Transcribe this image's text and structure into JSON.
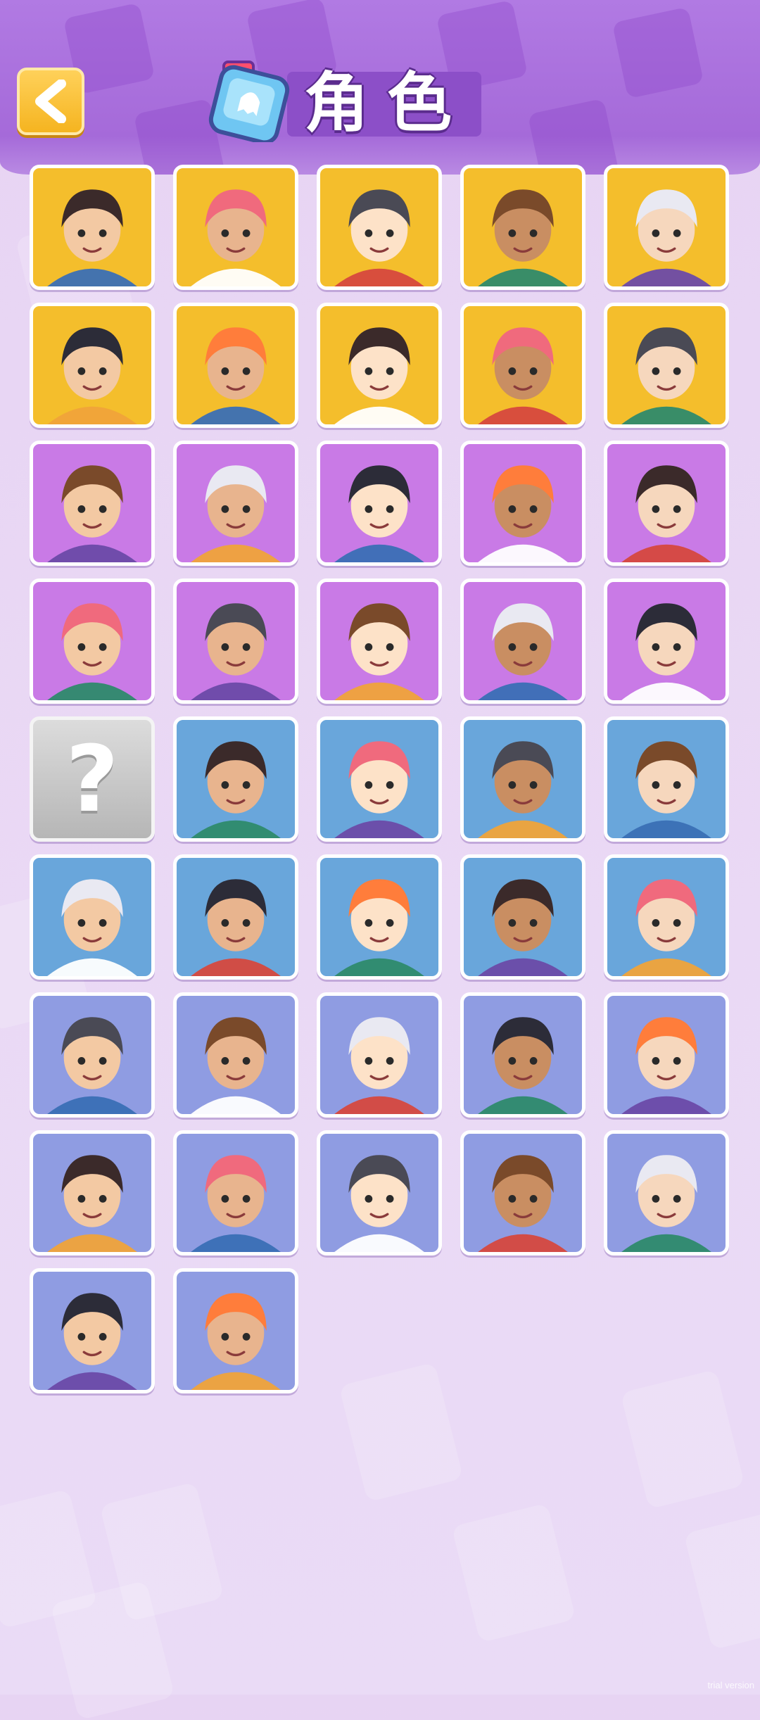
{
  "header": {
    "title": "角色",
    "back_icon": "chevron-left-icon",
    "title_icon": "character-card-icon"
  },
  "colors": {
    "yellow": "#f4be2c",
    "magenta": "#c97ae6",
    "blue": "#69a6db",
    "periwinkle": "#8f9ce2",
    "header": "#a56ad9"
  },
  "roster": [
    {
      "theme": "yellow",
      "locked": false,
      "label": ""
    },
    {
      "theme": "yellow",
      "locked": false,
      "label": ""
    },
    {
      "theme": "yellow",
      "locked": false,
      "label": ""
    },
    {
      "theme": "yellow",
      "locked": false,
      "label": ""
    },
    {
      "theme": "yellow",
      "locked": false,
      "label": ""
    },
    {
      "theme": "yellow",
      "locked": false,
      "label": ""
    },
    {
      "theme": "yellow",
      "locked": false,
      "label": ""
    },
    {
      "theme": "yellow",
      "locked": false,
      "label": ""
    },
    {
      "theme": "yellow",
      "locked": false,
      "label": ""
    },
    {
      "theme": "yellow",
      "locked": false,
      "label": ""
    },
    {
      "theme": "magenta",
      "locked": false,
      "label": ""
    },
    {
      "theme": "magenta",
      "locked": false,
      "label": ""
    },
    {
      "theme": "magenta",
      "locked": false,
      "label": ""
    },
    {
      "theme": "magenta",
      "locked": false,
      "label": ""
    },
    {
      "theme": "magenta",
      "locked": false,
      "label": ""
    },
    {
      "theme": "magenta",
      "locked": false,
      "label": ""
    },
    {
      "theme": "magenta",
      "locked": false,
      "label": ""
    },
    {
      "theme": "magenta",
      "locked": false,
      "label": ""
    },
    {
      "theme": "magenta",
      "locked": false,
      "label": ""
    },
    {
      "theme": "magenta",
      "locked": false,
      "label": ""
    },
    {
      "theme": "locked",
      "locked": true,
      "label": "?"
    },
    {
      "theme": "blue",
      "locked": false,
      "label": ""
    },
    {
      "theme": "blue",
      "locked": false,
      "label": ""
    },
    {
      "theme": "blue",
      "locked": false,
      "label": ""
    },
    {
      "theme": "blue",
      "locked": false,
      "label": ""
    },
    {
      "theme": "blue",
      "locked": false,
      "label": ""
    },
    {
      "theme": "blue",
      "locked": false,
      "label": ""
    },
    {
      "theme": "blue",
      "locked": false,
      "label": ""
    },
    {
      "theme": "blue",
      "locked": false,
      "label": ""
    },
    {
      "theme": "blue",
      "locked": false,
      "label": ""
    },
    {
      "theme": "periwinkle",
      "locked": false,
      "label": ""
    },
    {
      "theme": "periwinkle",
      "locked": false,
      "label": ""
    },
    {
      "theme": "periwinkle",
      "locked": false,
      "label": ""
    },
    {
      "theme": "periwinkle",
      "locked": false,
      "label": ""
    },
    {
      "theme": "periwinkle",
      "locked": false,
      "label": ""
    },
    {
      "theme": "periwinkle",
      "locked": false,
      "label": ""
    },
    {
      "theme": "periwinkle",
      "locked": false,
      "label": ""
    },
    {
      "theme": "periwinkle",
      "locked": false,
      "label": ""
    },
    {
      "theme": "periwinkle",
      "locked": false,
      "label": ""
    },
    {
      "theme": "periwinkle",
      "locked": false,
      "label": ""
    },
    {
      "theme": "periwinkle",
      "locked": false,
      "label": ""
    },
    {
      "theme": "periwinkle",
      "locked": false,
      "label": ""
    }
  ],
  "watermark": "trial version"
}
